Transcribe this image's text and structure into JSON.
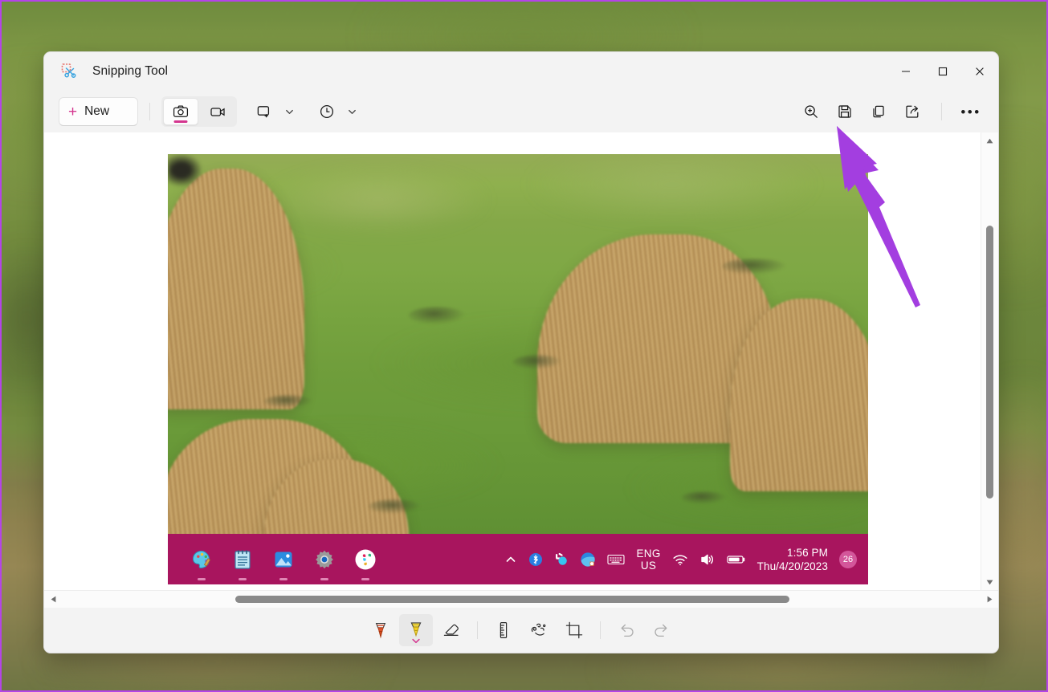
{
  "window": {
    "title": "Snipping Tool",
    "app_icon": "snipping-tool-icon",
    "controls": {
      "minimize": "–",
      "maximize": "☐",
      "close": "✕"
    }
  },
  "command_bar": {
    "new_button": {
      "label": "New",
      "icon": "plus-icon"
    },
    "modes": [
      {
        "name": "snip-mode-camera",
        "icon": "camera-icon",
        "selected": true
      },
      {
        "name": "snip-mode-video",
        "icon": "video-camera-icon",
        "selected": false
      }
    ],
    "snip_shape": {
      "icon": "rectangle-snip-icon",
      "chevron": "chevron-down-icon"
    },
    "delay": {
      "icon": "clock-icon",
      "chevron": "chevron-down-icon"
    },
    "actions": [
      {
        "name": "zoom-button",
        "icon": "magnifier-plus-icon"
      },
      {
        "name": "save-button",
        "icon": "save-floppy-icon"
      },
      {
        "name": "copy-button",
        "icon": "copy-icon"
      },
      {
        "name": "share-button",
        "icon": "share-icon"
      },
      {
        "name": "more-button",
        "icon": "ellipsis-icon",
        "label": "•••"
      }
    ]
  },
  "captured_image": {
    "description": "Screenshot of a grassy field with dried tussocks and the Windows taskbar",
    "taskbar": {
      "background_color": "#a8155e",
      "pinned_apps": [
        {
          "name": "taskbar-paint",
          "icon": "paint-palette-icon",
          "glyph": "🎨"
        },
        {
          "name": "taskbar-notepad",
          "icon": "notepad-icon",
          "glyph": "📓"
        },
        {
          "name": "taskbar-photos",
          "icon": "photos-icon",
          "glyph": "🖼"
        },
        {
          "name": "taskbar-settings",
          "icon": "gear-icon",
          "glyph": "⚙"
        },
        {
          "name": "taskbar-slack",
          "icon": "slack-icon",
          "glyph": "✤"
        }
      ],
      "tray": {
        "overflow": {
          "name": "tray-overflow",
          "icon": "chevron-up-icon"
        },
        "bluetooth": {
          "name": "tray-bluetooth",
          "icon": "bluetooth-icon"
        },
        "slack_tray": {
          "name": "tray-slack",
          "icon": "slack-icon"
        },
        "browser_tray": {
          "name": "tray-browser",
          "icon": "browser-icon"
        },
        "keyboard": {
          "name": "tray-keyboard",
          "icon": "keyboard-icon"
        },
        "language": {
          "line1": "ENG",
          "line2": "US"
        },
        "wifi": {
          "name": "tray-wifi",
          "icon": "wifi-icon"
        },
        "volume": {
          "name": "tray-volume",
          "icon": "speaker-icon"
        },
        "battery": {
          "name": "tray-battery",
          "icon": "battery-icon"
        },
        "clock": {
          "time": "1:56 PM",
          "date": "Thu/4/20/2023"
        },
        "notification_badge": "26"
      }
    }
  },
  "editor_tools": [
    {
      "name": "ballpoint-pen-tool",
      "icon": "pen-icon",
      "selected": false,
      "color": "#d94a1e"
    },
    {
      "name": "highlighter-tool",
      "icon": "highlighter-icon",
      "selected": true,
      "color": "#f2cf22"
    },
    {
      "name": "eraser-tool",
      "icon": "eraser-icon",
      "selected": false
    },
    {
      "name": "ruler-tool",
      "icon": "ruler-icon",
      "selected": false
    },
    {
      "name": "touch-writing-tool",
      "icon": "touch-writing-icon",
      "selected": false
    },
    {
      "name": "crop-tool",
      "icon": "crop-icon",
      "selected": false
    },
    {
      "name": "undo-button",
      "icon": "undo-arrow-icon",
      "selected": false,
      "disabled": true
    },
    {
      "name": "redo-button",
      "icon": "redo-arrow-icon",
      "selected": false,
      "disabled": true
    }
  ],
  "scrollbars": {
    "vertical": {
      "up_arrow": "▲",
      "down_arrow": "▼",
      "thumb_top_pct": 20,
      "thumb_height_pct": 59
    },
    "horizontal": {
      "left_arrow": "◀",
      "right_arrow": "▶",
      "thumb_left_pct": 20,
      "thumb_width_pct": 59
    }
  },
  "annotation": {
    "arrow": {
      "name": "pointer-arrow",
      "color": "#a33ee0",
      "points_to": "save-button"
    }
  },
  "colors": {
    "accent_pink": "#d4368f",
    "taskbar_pink": "#a8155e",
    "annotation_purple": "#a33ee0",
    "window_chrome": "#f3f3f3",
    "border_purple": "#b444e8"
  }
}
